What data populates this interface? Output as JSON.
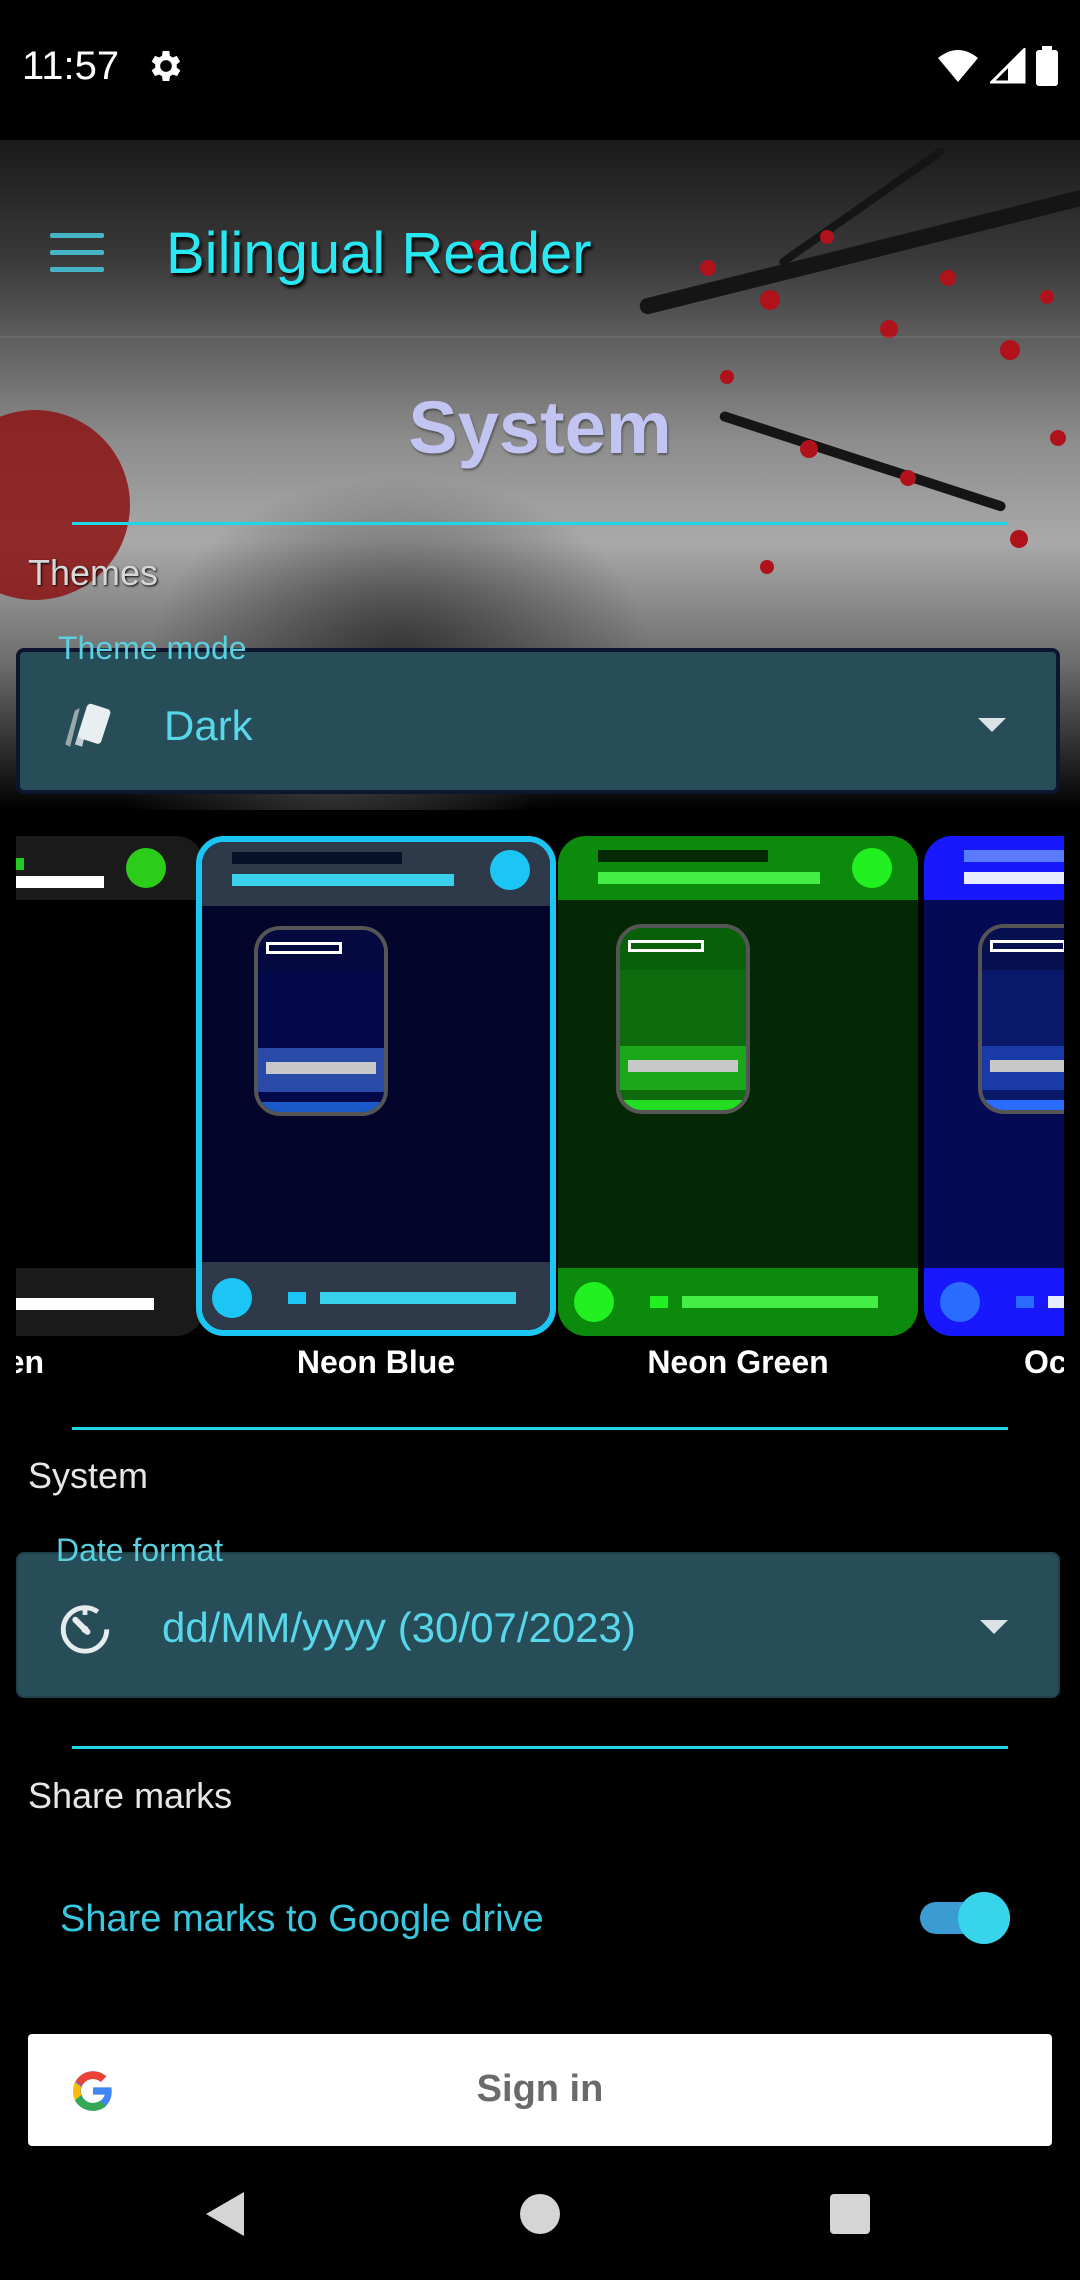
{
  "status_bar": {
    "time": "11:57"
  },
  "app_bar": {
    "title": "Bilingual Reader",
    "menu_icon": "hamburger-menu-icon"
  },
  "page": {
    "title": "System"
  },
  "themes_section": {
    "label": "Themes",
    "theme_mode": {
      "legend": "Theme mode",
      "value": "Dark",
      "icon": "palette-cards-icon"
    },
    "cards": [
      {
        "label": "en",
        "bg": "#000000",
        "top": "#1a1a1a",
        "accent": "#2bcc1a",
        "selected": false
      },
      {
        "label": "Neon Blue",
        "bg": "#03062a",
        "top": "#2e3a4a",
        "accent": "#1cc6f4",
        "selected": true
      },
      {
        "label": "Neon Green",
        "bg": "#032803",
        "top": "#0b8a0b",
        "accent": "#21f021",
        "selected": false
      },
      {
        "label": "Oce",
        "bg": "#050a55",
        "top": "#1818ff",
        "accent": "#2a6cff",
        "selected": false
      }
    ]
  },
  "system_section": {
    "label": "System",
    "date_format": {
      "legend": "Date format",
      "value": "dd/MM/yyyy (30/07/2023)",
      "icon": "timer-icon"
    }
  },
  "share_section": {
    "label": "Share marks",
    "toggle_label": "Share marks to Google drive",
    "toggle_on": true
  },
  "signin": {
    "label": "Sign in",
    "icon": "google-logo-icon"
  },
  "colors": {
    "accent": "#1ed8e8",
    "dropdown_bg": "#264d58",
    "title": "#c2c4f2"
  }
}
